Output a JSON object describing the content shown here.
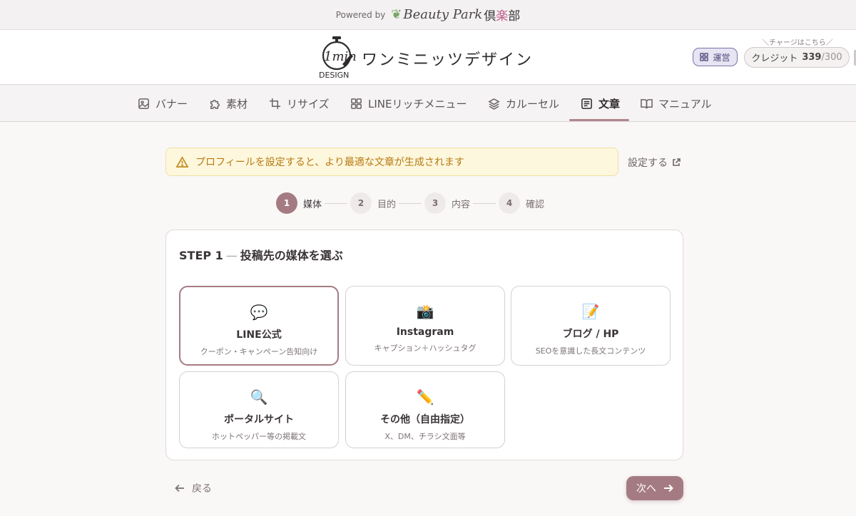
{
  "powered": {
    "label": "Powered by",
    "brand_latin": "Beauty Park",
    "brand_kanji_1": "倶",
    "brand_kanji_2": "楽",
    "brand_kanji_3": "部"
  },
  "header": {
    "logo_top": "1min",
    "logo_bottom": "DESIGN",
    "app_title": "ワンミニッツデザイン",
    "admin_label": "運営",
    "charge_note": "＼チャージはこちら／",
    "credit_label": "クレジット",
    "credit_value": "339",
    "credit_max": "/300"
  },
  "nav": {
    "items": [
      {
        "label": "バナー",
        "icon": "image-icon"
      },
      {
        "label": "素材",
        "icon": "puzzle-icon"
      },
      {
        "label": "リサイズ",
        "icon": "crop-icon"
      },
      {
        "label": "LINEリッチメニュー",
        "icon": "grid-icon"
      },
      {
        "label": "カルーセル",
        "icon": "layers-icon"
      },
      {
        "label": "文章",
        "icon": "document-icon",
        "active": true
      },
      {
        "label": "マニュアル",
        "icon": "book-icon"
      }
    ]
  },
  "alert": {
    "message": "プロフィールを設定すると、より最適な文章が生成されます",
    "link_label": "設定する"
  },
  "steps": [
    {
      "num": "1",
      "label": "媒体",
      "active": true
    },
    {
      "num": "2",
      "label": "目的"
    },
    {
      "num": "3",
      "label": "内容"
    },
    {
      "num": "4",
      "label": "確認"
    }
  ],
  "panel": {
    "step_label": "STEP 1",
    "dash": "—",
    "title": "投稿先の媒体を選ぶ",
    "options": [
      {
        "emoji": "💬",
        "title": "LINE公式",
        "sub": "クーポン・キャンペーン告知向け",
        "selected": true
      },
      {
        "emoji": "📸",
        "title": "Instagram",
        "sub": "キャプション＋ハッシュタグ"
      },
      {
        "emoji": "📝",
        "title": "ブログ / HP",
        "sub": "SEOを意識した長文コンテンツ"
      },
      {
        "emoji": "🔍",
        "title": "ポータルサイト",
        "sub": "ホットペッパー等の掲載文"
      },
      {
        "emoji": "✏️",
        "title": "その他（自由指定）",
        "sub": "X、DM、チラシ文面等"
      }
    ]
  },
  "footer": {
    "back_label": "戻る",
    "next_label": "次へ"
  },
  "colors": {
    "accent": "#a57b83",
    "alert_text": "#b77a12",
    "admin_border": "#7b72a8"
  }
}
